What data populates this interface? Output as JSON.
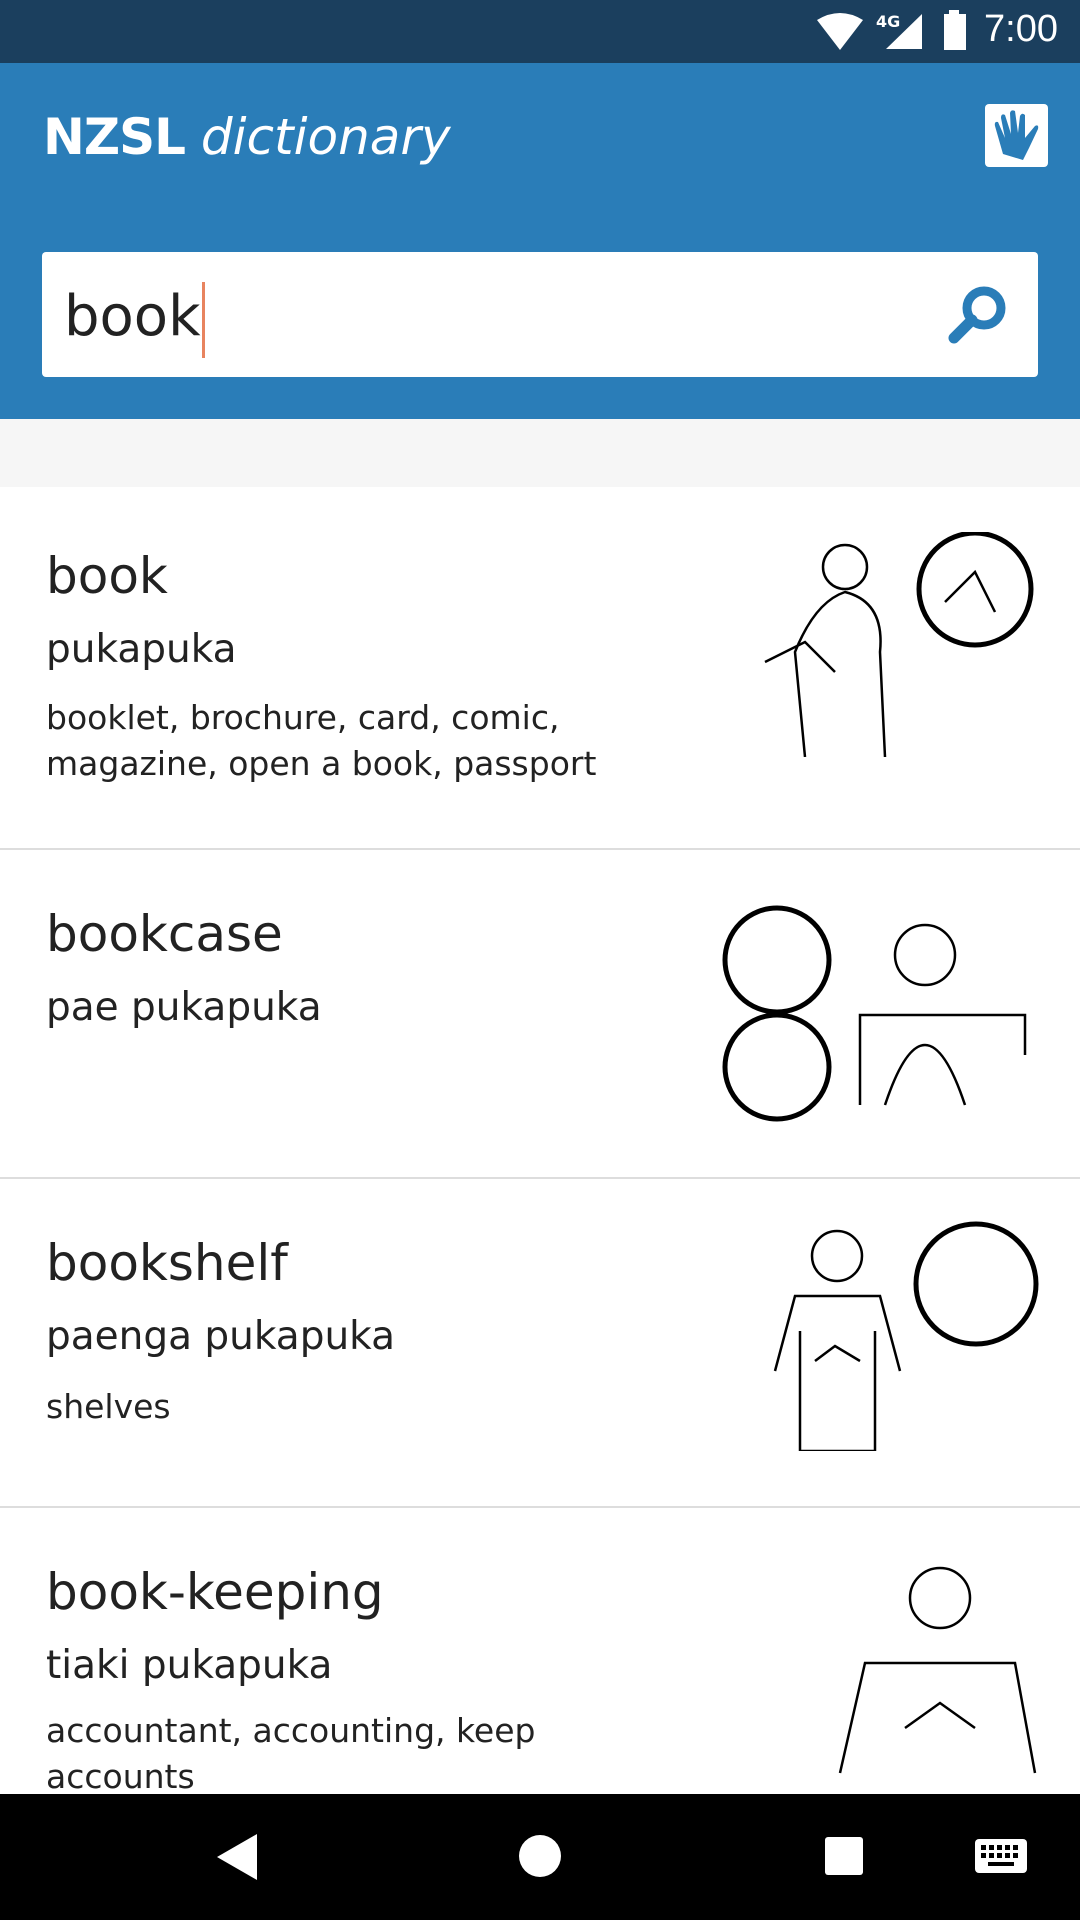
{
  "status_bar": {
    "network": "4G",
    "time": "7:00"
  },
  "header": {
    "title_bold": "NZSL",
    "title_italic": "dictionary",
    "icon": "hand-icon"
  },
  "search": {
    "value": "book",
    "icon": "search-icon"
  },
  "results": [
    {
      "word": "book",
      "maori": "pukapuka",
      "glosses": "booklet, brochure, card, comic, magazine, open a book, passport"
    },
    {
      "word": "bookcase",
      "maori": "pae pukapuka",
      "glosses": ""
    },
    {
      "word": "bookshelf",
      "maori": "paenga pukapuka",
      "glosses": "shelves"
    },
    {
      "word": "book-keeping",
      "maori": "tiaki pukapuka",
      "glosses": "accountant, accounting, keep accounts"
    }
  ],
  "colors": {
    "status_bar": "#1b3f5e",
    "app_bar": "#2a7db8",
    "caret": "#e8845f"
  }
}
